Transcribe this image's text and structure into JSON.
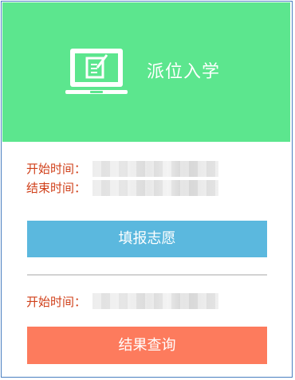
{
  "header": {
    "title": "派位入学",
    "icon": "laptop-edit-icon",
    "background": "#5ce68e"
  },
  "fill_section": {
    "start_label": "开始时间：",
    "end_label": "结束时间：",
    "button_label": "填报志愿",
    "button_color": "#5bb8de"
  },
  "result_section": {
    "start_label": "开始时间：",
    "button_label": "结果查询",
    "button_color": "#fd7b5d"
  },
  "label_color": "#d0401a"
}
